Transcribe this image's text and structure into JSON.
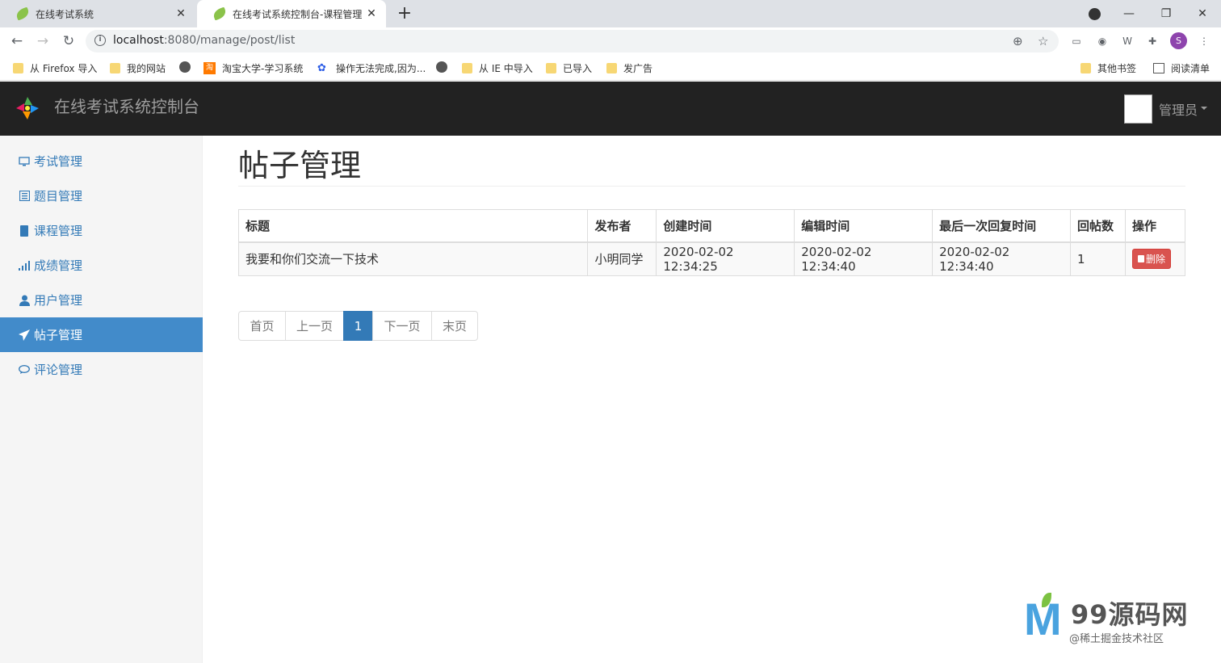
{
  "browser": {
    "tabs": [
      {
        "title": "在线考试系统",
        "active": false
      },
      {
        "title": "在线考试系统控制台-课程管理",
        "active": true
      }
    ],
    "url_host": "localhost",
    "url_rest": ":8080/manage/post/list",
    "bookmarks": [
      {
        "label": "从 Firefox 导入",
        "icon": "folder-icon"
      },
      {
        "label": "我的网站",
        "icon": "folder-icon"
      },
      {
        "label": "",
        "icon": "globe-icon"
      },
      {
        "label": "淘宝大学-学习系统",
        "icon": "taobao-icon"
      },
      {
        "label": "操作无法完成,因为...",
        "icon": "baidu-paw-icon"
      },
      {
        "label": "",
        "icon": "globe-icon"
      },
      {
        "label": "从 IE 中导入",
        "icon": "folder-icon"
      },
      {
        "label": "已导入",
        "icon": "folder-icon"
      },
      {
        "label": "发广告",
        "icon": "folder-icon"
      },
      {
        "label": "其他书签",
        "icon": "folder-icon"
      },
      {
        "label": "阅读清单",
        "icon": "reading-list-icon"
      }
    ],
    "profile_initial": "S"
  },
  "header": {
    "brand": "在线考试系统控制台",
    "user_name": "管理员"
  },
  "sidebar": {
    "items": [
      {
        "label": "考试管理",
        "icon": "monitor-icon",
        "active": false
      },
      {
        "label": "题目管理",
        "icon": "list-alt-icon",
        "active": false
      },
      {
        "label": "课程管理",
        "icon": "book-icon",
        "active": false
      },
      {
        "label": "成绩管理",
        "icon": "signal-icon",
        "active": false
      },
      {
        "label": "用户管理",
        "icon": "user-icon",
        "active": false
      },
      {
        "label": "帖子管理",
        "icon": "send-icon",
        "active": true
      },
      {
        "label": "评论管理",
        "icon": "comment-icon",
        "active": false
      }
    ]
  },
  "main": {
    "title": "帖子管理",
    "table": {
      "headers": [
        "标题",
        "发布者",
        "创建时间",
        "编辑时间",
        "最后一次回复时间",
        "回帖数",
        "操作"
      ],
      "rows": [
        [
          "我要和你们交流一下技术",
          "小明同学",
          "2020-02-02 12:34:25",
          "2020-02-02 12:34:40",
          "2020-02-02 12:34:40",
          "1"
        ]
      ],
      "delete_label": "删除"
    },
    "pager": {
      "first": "首页",
      "prev": "上一页",
      "current": "1",
      "next": "下一页",
      "last": "末页"
    }
  },
  "watermark": {
    "big": "99源码网",
    "small": "@稀土掘金技术社区"
  },
  "colors": {
    "header_bg": "#222222",
    "sidebar_active": "#428bca",
    "link": "#337ab7",
    "danger": "#d9534f"
  }
}
